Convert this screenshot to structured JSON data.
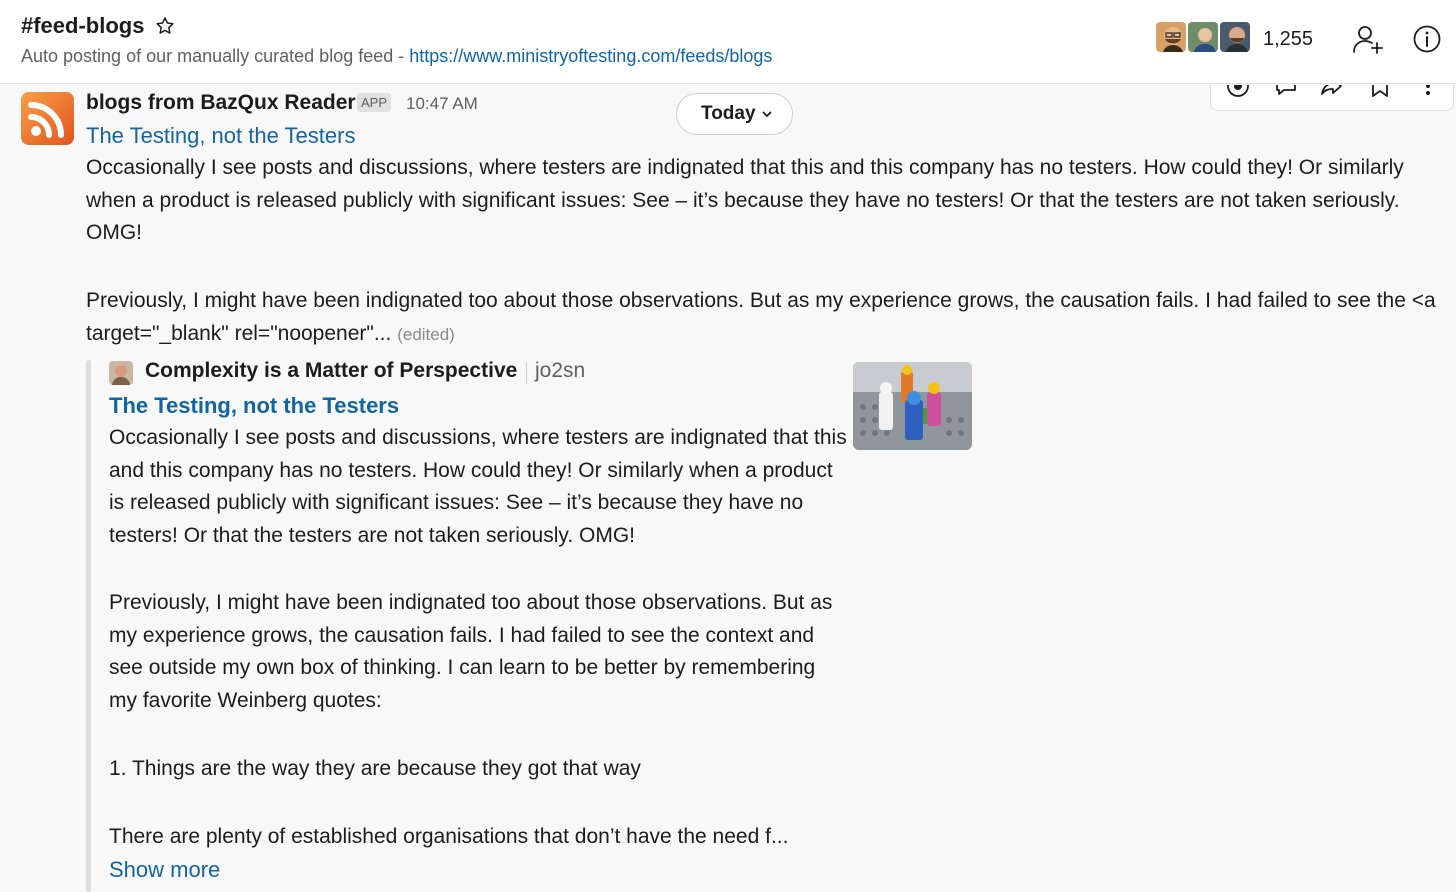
{
  "channel": {
    "name": "#feed-blogs",
    "topic_prefix": "Auto posting of our manually curated blog feed - ",
    "topic_link": "https://www.ministryoftesting.com/feeds/blogs",
    "member_count": "1,255"
  },
  "icons": {
    "star": "star-icon",
    "add_member": "add-person-icon",
    "details": "info-icon",
    "app": "rss-icon",
    "date_menu": "chevron-down-icon"
  },
  "message": {
    "sender": "blogs from BazQux Reader",
    "badge": "APP",
    "time": "10:47 AM",
    "title": "The Testing, not the Testers",
    "paragraph1": "Occasionally I see posts and discussions, where testers are indignated that this and this company has no testers. How could they! Or similarly when a product is released publicly with significant issues: See – it’s because they have no testers! Or that the testers are not taken seriously. OMG!",
    "paragraph2": "Previously, I might have been indignated too about those observations. But as my experience grows, the causation fails. I had failed to see the <a target=\"_blank\" rel=\"noopener\"...",
    "edited": "(edited)"
  },
  "date_divider": {
    "label": "Today"
  },
  "unfurl": {
    "site_name": "Complexity is a Matter of Perspective",
    "author": "jo2sn",
    "title": "The Testing, not the Testers",
    "paragraph1": "Occasionally I see posts and discussions, where testers are indignated that this and this company has no testers. How could they! Or similarly when a product is released publicly with significant issues: See – it’s because they have no testers! Or that the testers are not taken seriously. OMG!",
    "paragraph2": "Previously, I might have been indignated too about those observations. But as my experience grows, the causation fails. I had failed to see the context and see outside my own box of thinking. I can learn to be better by remembering my favorite Weinberg quotes:",
    "paragraph3": "1. Things are the way they are because they got that way",
    "paragraph4": "There are plenty of established organisations that don’t have the need f...",
    "show_more": "Show more"
  },
  "colors": {
    "link": "#1264a3",
    "text": "#1d1c1d",
    "muted": "#616061",
    "rss_orange": "#ef6c2c",
    "attachment_bar": "#dddddd"
  }
}
